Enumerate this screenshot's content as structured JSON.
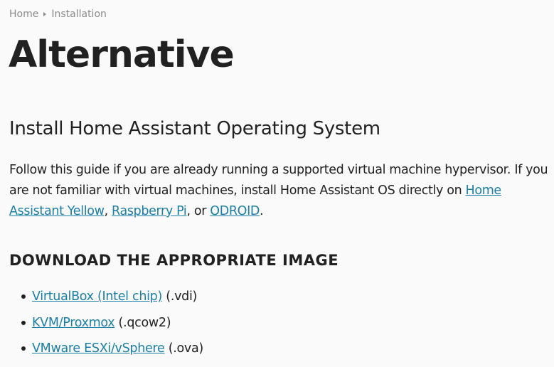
{
  "breadcrumb": {
    "home": "Home",
    "current": "Installation"
  },
  "page_title": "Alternative",
  "section_title": "Install Home Assistant Operating System",
  "intro": {
    "text_before": "Follow this guide if you are already running a supported virtual machine hypervisor. If you are not familiar with virtual machines, install Home Assistant OS directly on ",
    "link_yellow": "Home Assistant Yellow",
    "sep1": ", ",
    "link_rpi": "Raspberry Pi",
    "sep2": ", or ",
    "link_odroid": "ODROID",
    "text_after": "."
  },
  "download_heading": "DOWNLOAD THE APPROPRIATE IMAGE",
  "downloads": [
    {
      "link": "VirtualBox (Intel chip)",
      "ext": " (.vdi)"
    },
    {
      "link": "KVM/Proxmox",
      "ext": " (.qcow2)"
    },
    {
      "link": "VMware ESXi/vSphere",
      "ext": " (.ova)"
    }
  ]
}
